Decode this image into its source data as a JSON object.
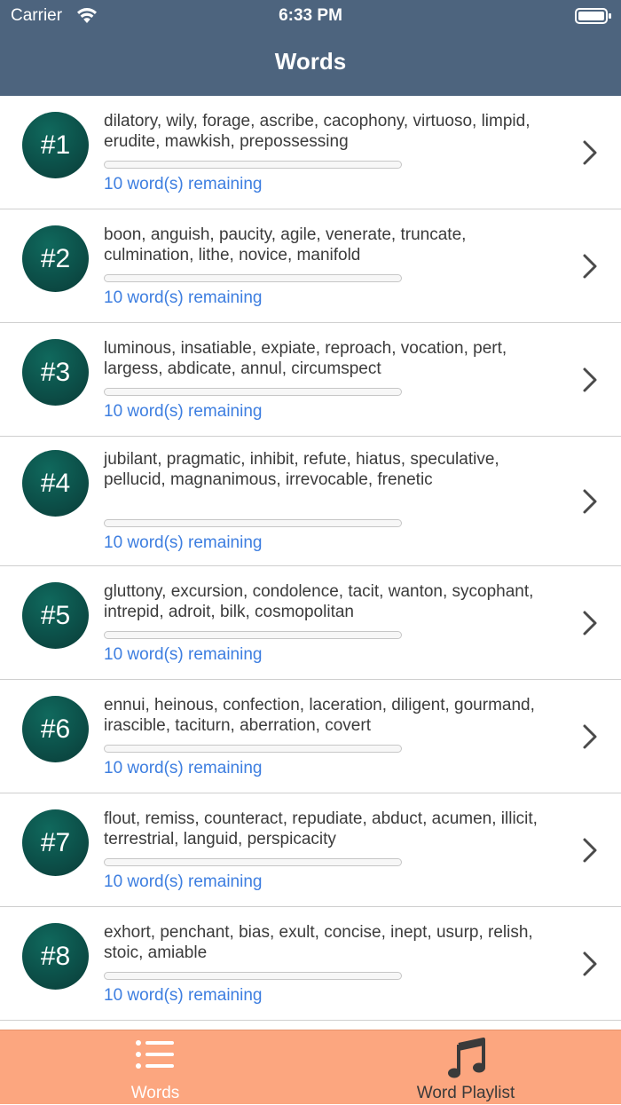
{
  "status_bar": {
    "carrier": "Carrier",
    "time": "6:33 PM"
  },
  "nav": {
    "title": "Words"
  },
  "lists": [
    {
      "number": "#1",
      "words": "dilatory, wily, forage, ascribe, cacophony, virtuoso, limpid, erudite, mawkish, prepossessing",
      "remaining": "10 word(s) remaining",
      "progress": 0
    },
    {
      "number": "#2",
      "words": "boon, anguish, paucity, agile, venerate, truncate, culmination, lithe, novice, manifold",
      "remaining": "10 word(s) remaining",
      "progress": 0
    },
    {
      "number": "#3",
      "words": "luminous, insatiable, expiate, reproach, vocation, pert, largess, abdicate, annul, circumspect",
      "remaining": "10 word(s) remaining",
      "progress": 0
    },
    {
      "number": "#4",
      "words": "jubilant, pragmatic, inhibit, refute, hiatus, speculative, pellucid, magnanimous, irrevocable, frenetic",
      "remaining": "10 word(s) remaining",
      "progress": 0
    },
    {
      "number": "#5",
      "words": "gluttony, excursion, condolence, tacit, wanton, sycophant, intrepid, adroit, bilk, cosmopolitan",
      "remaining": "10 word(s) remaining",
      "progress": 0
    },
    {
      "number": "#6",
      "words": "ennui, heinous, confection, laceration, diligent, gourmand, irascible, taciturn, aberration, covert",
      "remaining": "10 word(s) remaining",
      "progress": 0
    },
    {
      "number": "#7",
      "words": "flout, remiss, counteract, repudiate, abduct, acumen, illicit, terrestrial, languid, perspicacity",
      "remaining": "10 word(s) remaining",
      "progress": 0
    },
    {
      "number": "#8",
      "words": "exhort, penchant, bias, exult, concise, inept, usurp, relish, stoic, amiable",
      "remaining": "10 word(s) remaining",
      "progress": 0
    }
  ],
  "tabbar": {
    "tabs": [
      {
        "label": "Words",
        "icon": "list-icon",
        "selected": true
      },
      {
        "label": "Word Playlist",
        "icon": "music-note-icon",
        "selected": false
      }
    ]
  },
  "colors": {
    "nav_background": "#4d647e",
    "badge": "#0c5049",
    "remaining_text": "#3d7ee0",
    "tabbar_background": "#fca67f"
  }
}
